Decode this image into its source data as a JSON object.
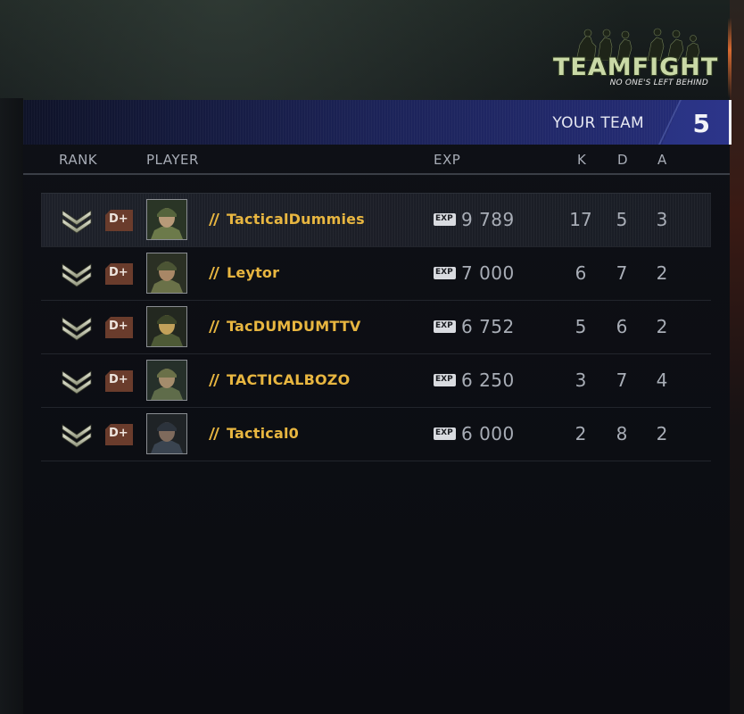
{
  "logo": {
    "title": "TEAMFIGHT",
    "tagline": "NO ONE'S LEFT BEHIND"
  },
  "banner": {
    "label": "YOUR TEAM",
    "team_number": "5"
  },
  "columns": {
    "rank": "RANK",
    "player": "PLAYER",
    "exp": "EXP",
    "k": "K",
    "d": "D",
    "a": "A"
  },
  "rows": [
    {
      "rank_badge": "D+",
      "exp_tag": "EXP",
      "name": "TacticalDummies",
      "exp": "9 789",
      "k": "17",
      "d": "5",
      "a": "3"
    },
    {
      "rank_badge": "D+",
      "exp_tag": "EXP",
      "name": "Leytor",
      "exp": "7 000",
      "k": "6",
      "d": "7",
      "a": "2"
    },
    {
      "rank_badge": "D+",
      "exp_tag": "EXP",
      "name": "TacDUMDUMTTV",
      "exp": "6 752",
      "k": "5",
      "d": "6",
      "a": "2"
    },
    {
      "rank_badge": "D+",
      "exp_tag": "EXP",
      "name": "TACTICALBOZO",
      "exp": "6 250",
      "k": "3",
      "d": "7",
      "a": "4"
    },
    {
      "rank_badge": "D+",
      "exp_tag": "EXP",
      "name": "Tactical0",
      "exp": "6 000",
      "k": "2",
      "d": "8",
      "a": "2"
    }
  ],
  "icons": {
    "rank": "sergeant-chevron-icon",
    "clan": "gold-stripes-icon",
    "avatar": "soldier-portrait"
  },
  "colors": {
    "player_name": "#e8b640",
    "rank_badge": "#6a3c2c",
    "banner": "#262e7b"
  }
}
